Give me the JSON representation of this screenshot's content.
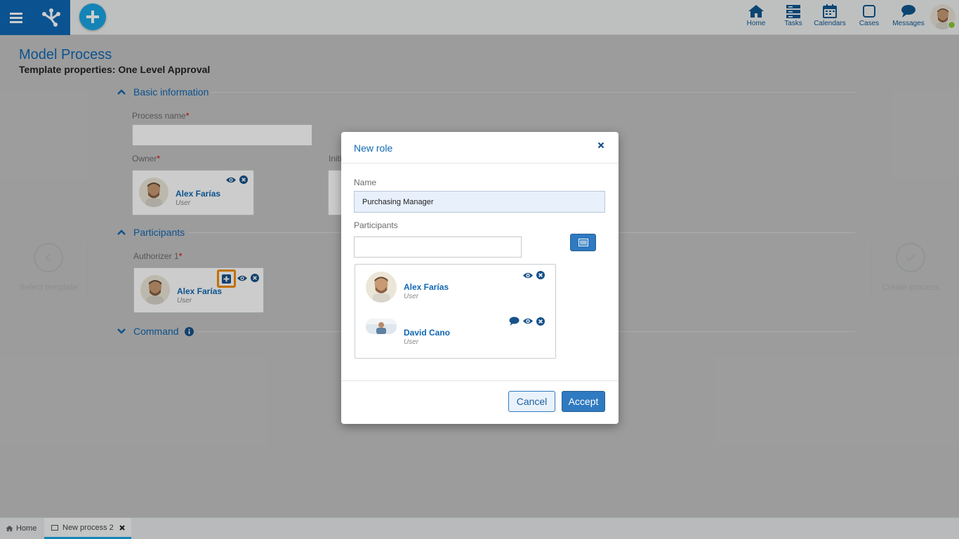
{
  "topbar": {
    "nav": [
      {
        "label": "Home",
        "icon": "home-icon"
      },
      {
        "label": "Tasks",
        "icon": "tasks-icon"
      },
      {
        "label": "Calendars",
        "icon": "calendar-icon"
      },
      {
        "label": "Cases",
        "icon": "cases-icon"
      },
      {
        "label": "Messages",
        "icon": "messages-icon"
      }
    ],
    "brand_color": "#0e68b4",
    "add_color": "#1aa6e4"
  },
  "page": {
    "title": "Model Process",
    "subtitle": "Template properties: One Level Approval",
    "basic_section": "Basic information",
    "process_name_label": "Process name",
    "owner_label": "Owner",
    "initiator_label": "Initi",
    "participants_section": "Participants",
    "authorizer_label": "Authorizer 1",
    "command_section": "Command",
    "owner_card": {
      "name": "Alex Farías",
      "role": "User"
    },
    "authorizer_card": {
      "name": "Alex Farías",
      "role": "User"
    },
    "step_prev": "Select template",
    "step_next": "Create process"
  },
  "bottom_tabs": [
    {
      "label": "Home",
      "icon": "home-icon"
    },
    {
      "label": "New process 2",
      "icon": "window-icon",
      "active": true
    }
  ],
  "modal": {
    "title": "New role",
    "name_label": "Name",
    "name_value": "Purchasing Manager",
    "participants_label": "Participants",
    "participants_search_value": "",
    "participants": [
      {
        "name": "Alex Farías",
        "role": "User"
      },
      {
        "name": "David Cano",
        "role": "User"
      }
    ],
    "cancel_label": "Cancel",
    "accept_label": "Accept"
  }
}
